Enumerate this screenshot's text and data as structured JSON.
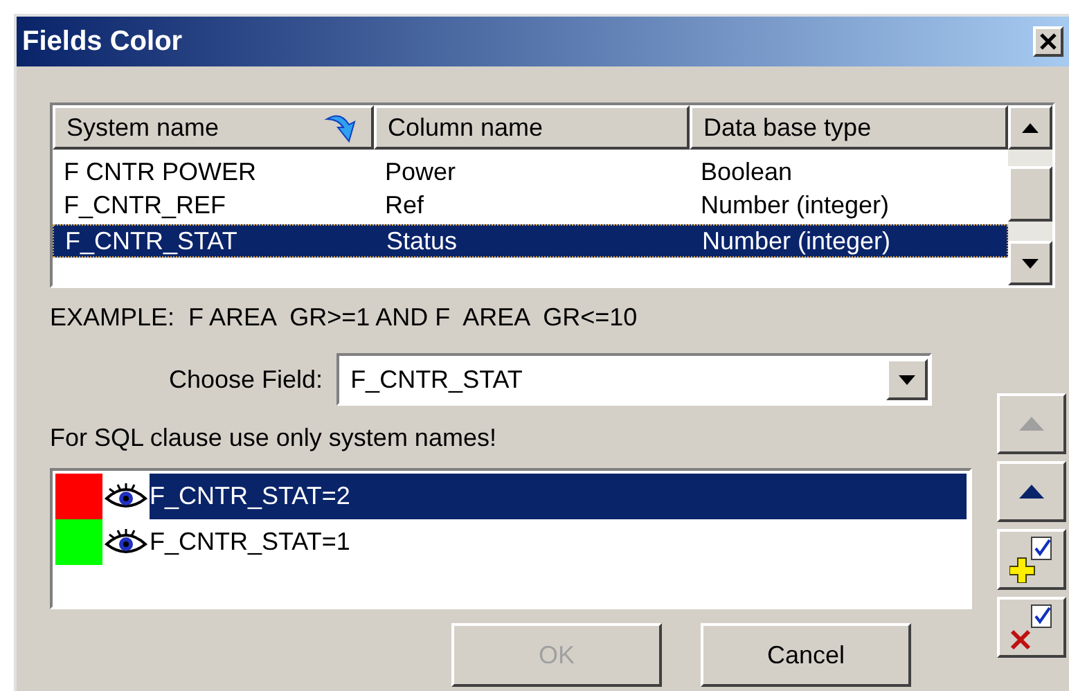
{
  "window": {
    "title": "Fields Color"
  },
  "fields_table": {
    "columns": [
      "System name",
      "Column name",
      "Data base type"
    ],
    "rows": [
      {
        "cells": [
          "F CNTR POWER",
          "Power",
          "Boolean"
        ],
        "selected": false
      },
      {
        "cells": [
          "F_CNTR_REF",
          "Ref",
          "Number (integer)"
        ],
        "selected": false
      },
      {
        "cells": [
          "F_CNTR_STAT",
          "Status",
          "Number (integer)"
        ],
        "selected": true
      }
    ]
  },
  "example": "EXAMPLE:  F AREA  GR>=1 AND F  AREA  GR<=10",
  "choose_field": {
    "label": "Choose Field:",
    "value": "F_CNTR_STAT"
  },
  "hint": "For SQL clause use only system names!",
  "rules": [
    {
      "condition": "F_CNTR_STAT=2",
      "color": "#ff0000",
      "selected": true
    },
    {
      "condition": "F_CNTR_STAT=1",
      "color": "#00ff00",
      "selected": false
    }
  ],
  "buttons": [
    {
      "label": "OK",
      "disabled": true
    },
    {
      "label": "Cancel",
      "disabled": false
    }
  ],
  "side_buttons": [
    {
      "kind": "up",
      "disabled": true
    },
    {
      "kind": "up",
      "disabled": false
    },
    {
      "kind": "add",
      "disabled": false
    },
    {
      "kind": "delete",
      "disabled": false
    }
  ]
}
